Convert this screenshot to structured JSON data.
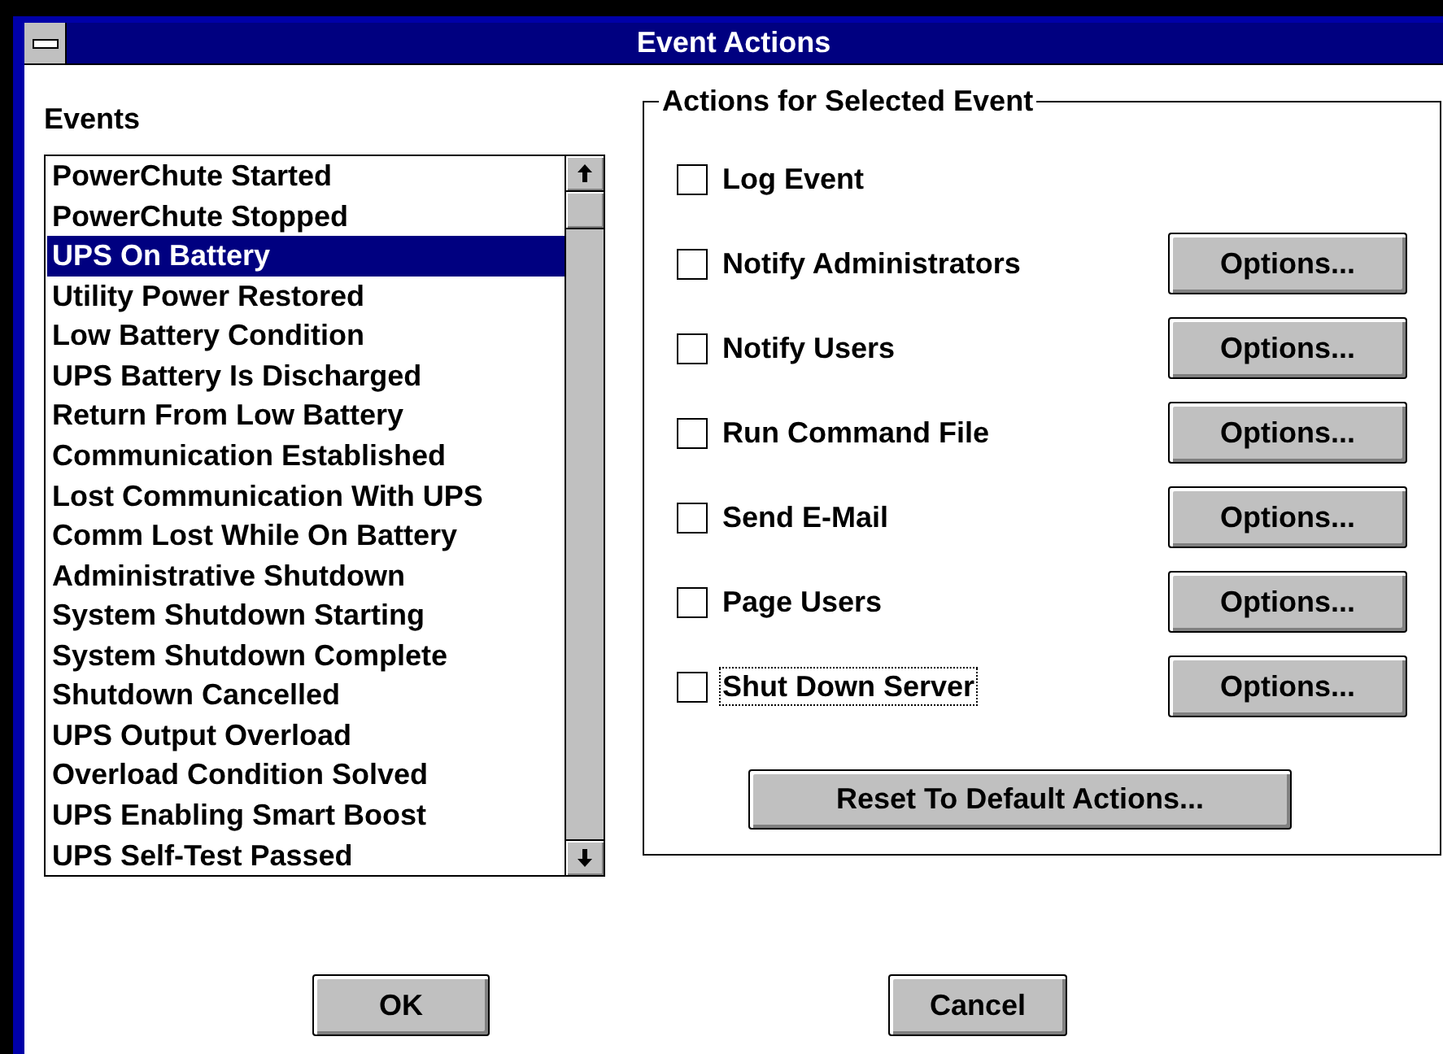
{
  "window": {
    "title": "Event Actions"
  },
  "events": {
    "label": "Events",
    "items": [
      {
        "label": "PowerChute Started",
        "selected": false
      },
      {
        "label": "PowerChute Stopped",
        "selected": false
      },
      {
        "label": "UPS On Battery",
        "selected": true
      },
      {
        "label": "Utility Power Restored",
        "selected": false
      },
      {
        "label": "Low Battery Condition",
        "selected": false
      },
      {
        "label": "UPS Battery Is Discharged",
        "selected": false
      },
      {
        "label": "Return From Low Battery",
        "selected": false
      },
      {
        "label": "Communication Established",
        "selected": false
      },
      {
        "label": "Lost Communication With UPS",
        "selected": false
      },
      {
        "label": "Comm Lost While On Battery",
        "selected": false
      },
      {
        "label": "Administrative Shutdown",
        "selected": false
      },
      {
        "label": "System Shutdown Starting",
        "selected": false
      },
      {
        "label": "System Shutdown Complete",
        "selected": false
      },
      {
        "label": "Shutdown Cancelled",
        "selected": false
      },
      {
        "label": "UPS Output Overload",
        "selected": false
      },
      {
        "label": "Overload Condition Solved",
        "selected": false
      },
      {
        "label": "UPS Enabling Smart Boost",
        "selected": false
      },
      {
        "label": "UPS Self-Test Passed",
        "selected": false
      }
    ]
  },
  "actions": {
    "title": "Actions for Selected Event",
    "items": [
      {
        "kind": "plain",
        "label": "Log Event",
        "checked": false,
        "focused": false
      },
      {
        "kind": "with_options",
        "label": "Notify Administrators",
        "checked": false,
        "focused": false,
        "button": "Options..."
      },
      {
        "kind": "with_options",
        "label": "Notify Users",
        "checked": false,
        "focused": false,
        "button": "Options..."
      },
      {
        "kind": "with_options",
        "label": "Run Command File",
        "checked": false,
        "focused": false,
        "button": "Options..."
      },
      {
        "kind": "with_options",
        "label": "Send E-Mail",
        "checked": false,
        "focused": false,
        "button": "Options..."
      },
      {
        "kind": "with_options",
        "label": "Page Users",
        "checked": false,
        "focused": false,
        "button": "Options..."
      },
      {
        "kind": "with_options",
        "label": "Shut Down Server",
        "checked": false,
        "focused": true,
        "button": "Options..."
      }
    ],
    "reset_button": "Reset To Default Actions..."
  },
  "buttons": [
    "OK",
    "Cancel"
  ]
}
